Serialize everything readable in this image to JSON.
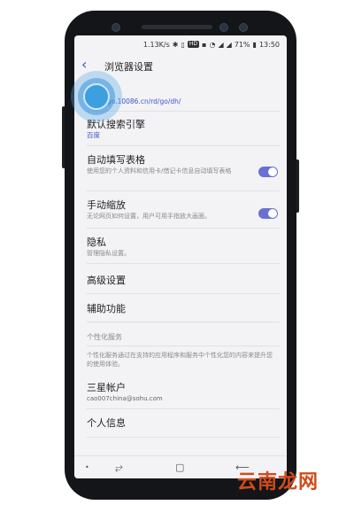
{
  "status_bar": {
    "speed": "1.13K/s",
    "hd_badge": "HD",
    "battery_percent": "71%",
    "time": "13:50"
  },
  "header": {
    "title": "浏览器设置"
  },
  "settings": {
    "home": {
      "title": "主页",
      "value": "http://go.10086.cn/rd/go/dh/"
    },
    "search_engine": {
      "title": "默认搜索引擎",
      "value": "百度"
    },
    "autofill": {
      "title": "自动填写表格",
      "desc": "使用您的个人资料和信用卡/借记卡信息自动填写表格",
      "enabled": true
    },
    "manual_zoom": {
      "title": "手动缩放",
      "desc": "无论网页如何设置，用户可用手指放大画面。",
      "enabled": true
    },
    "privacy": {
      "title": "隐私",
      "desc": "管理隐私设置。"
    },
    "advanced": {
      "title": "高级设置"
    },
    "accessibility": {
      "title": "辅助功能"
    },
    "personalization_section": "个性化服务",
    "personalization_desc": "个性化服务通过在支持的应用程序和服务中个性化您的内容来提升您的使用体验。",
    "samsung_account": {
      "title": "三星帐户",
      "value": "cao007china@sohu.com"
    },
    "personal_info": {
      "title": "个人信息"
    }
  },
  "watermark": "云南龙网",
  "colors": {
    "accent": "#3c55c5",
    "toggle_on": "#6a6fd3",
    "tap_highlight": "#3d9ee0"
  }
}
